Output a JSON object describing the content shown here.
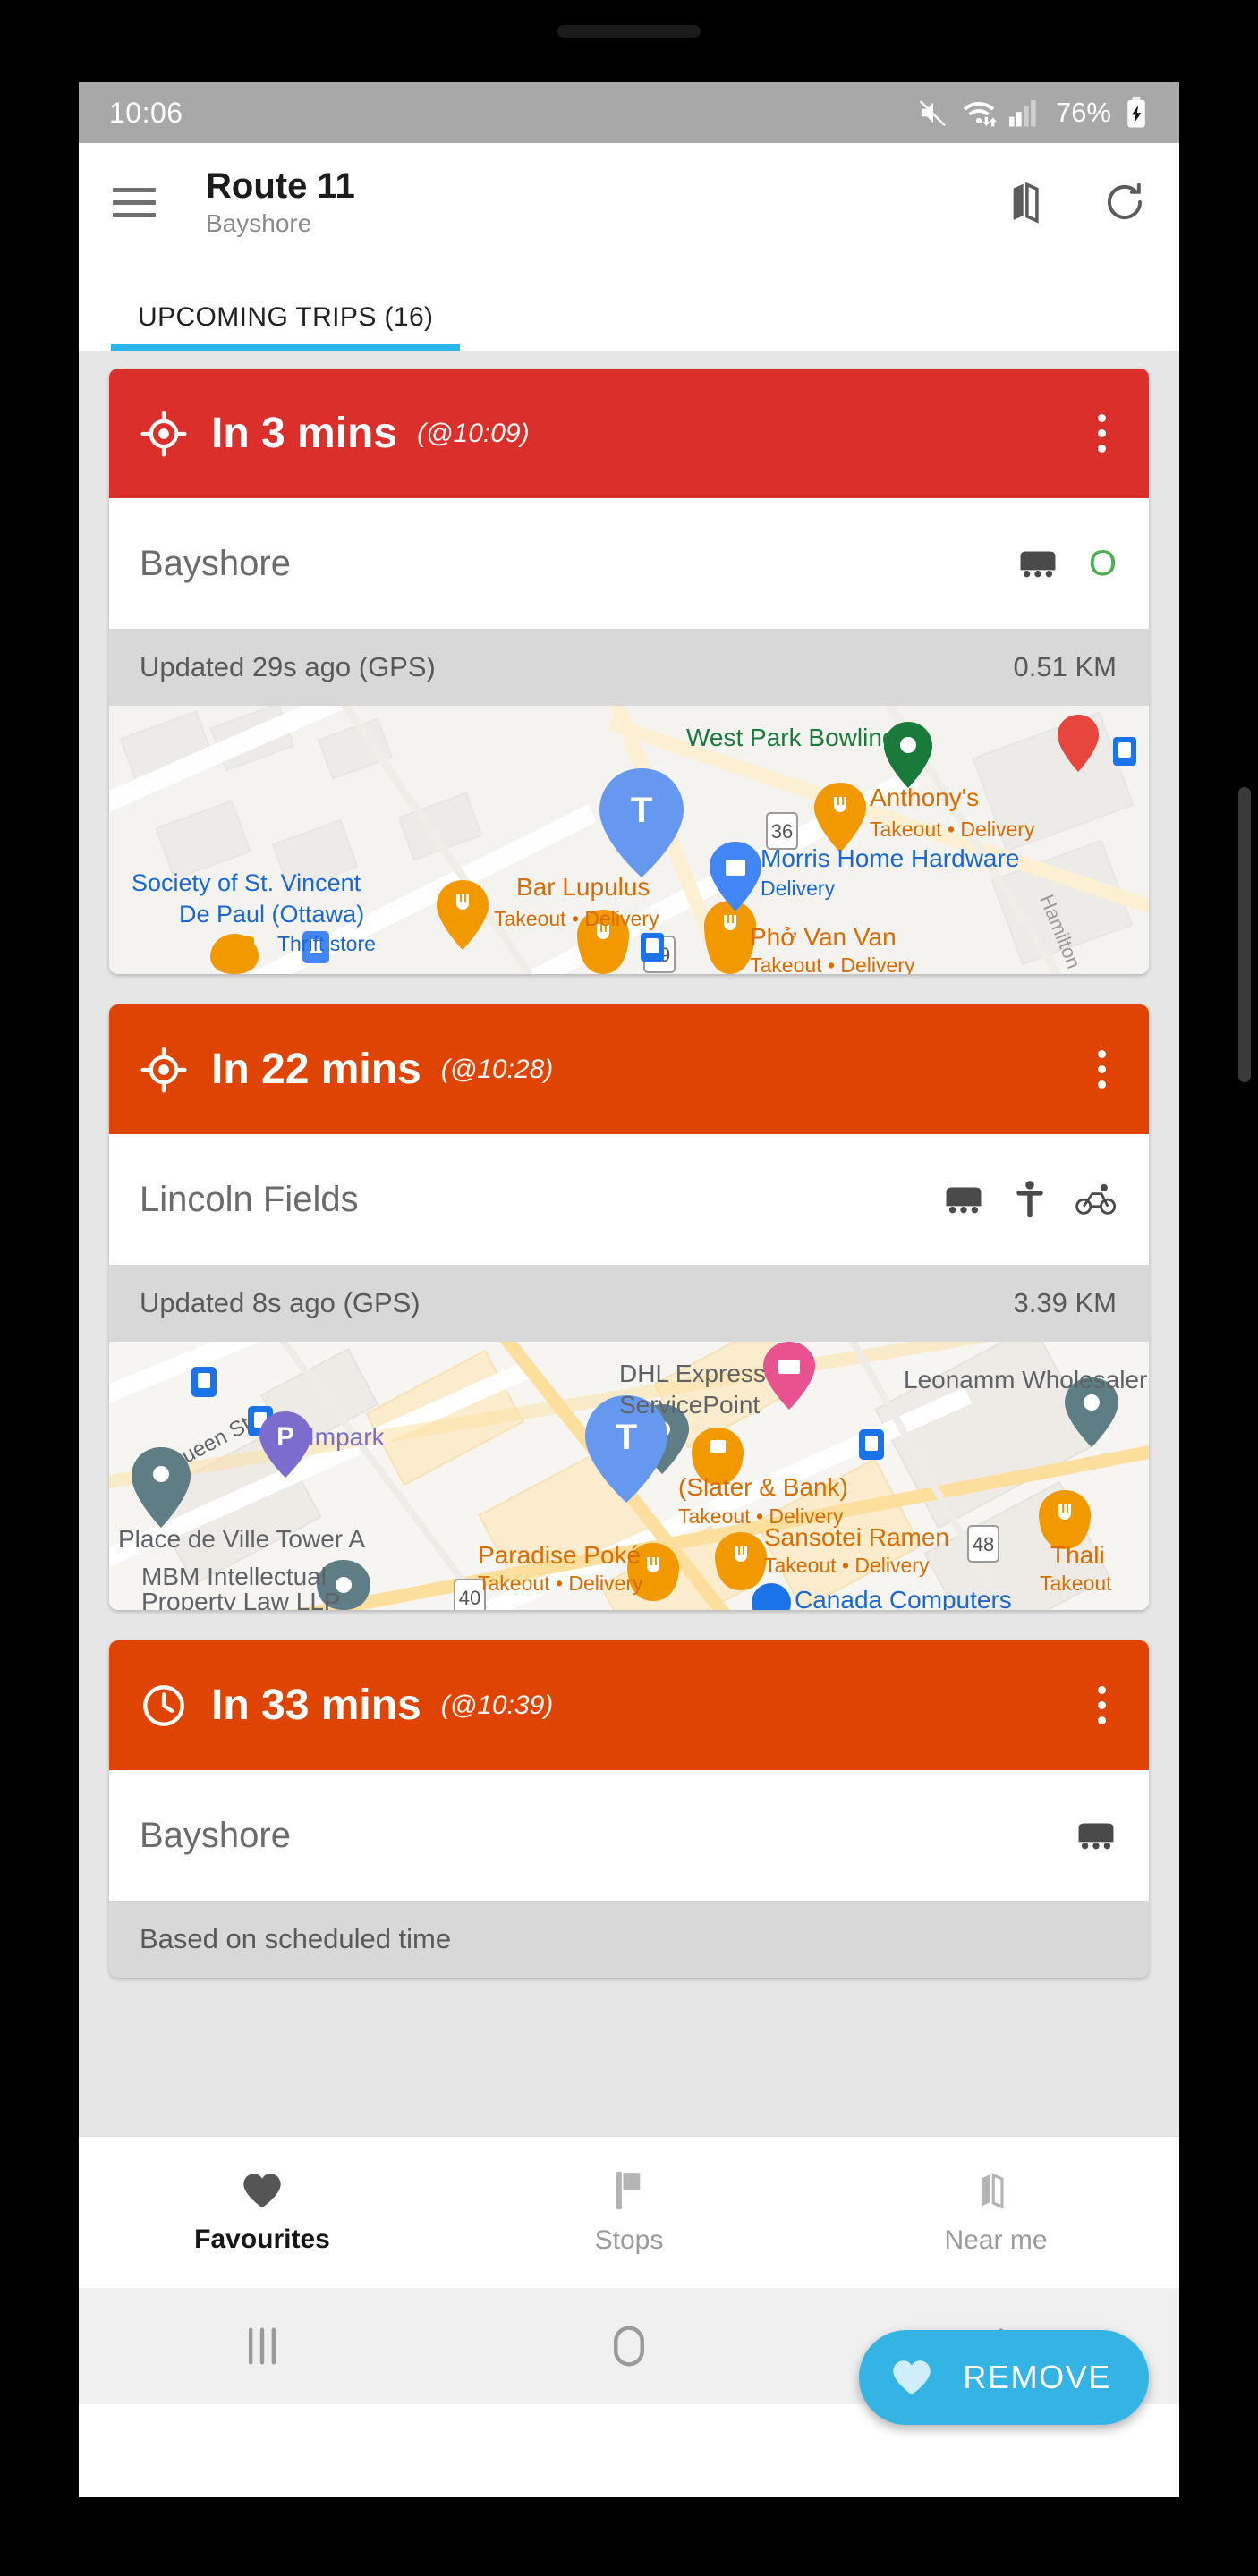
{
  "status_bar": {
    "clock": "10:06",
    "battery_percent": "76%",
    "icons": [
      "mute-icon",
      "wifi-icon",
      "signal-icon",
      "battery-charging-icon"
    ]
  },
  "app_bar": {
    "menu_icon": "hamburger-menu-icon",
    "title": "Route 11",
    "subtitle": "Bayshore",
    "map_icon": "map-icon",
    "refresh_icon": "refresh-icon"
  },
  "tabs": [
    {
      "label": "UPCOMING TRIPS (16)",
      "active": true
    }
  ],
  "trips": [
    {
      "eta": "In 3 mins",
      "time": "(@10:09)",
      "header_color": "#da2f2b",
      "header_icon": "gps-crosshair-icon",
      "destination": "Bayshore",
      "badges": [
        "bus-icon"
      ],
      "occupancy": "O",
      "occupancy_color": "#4caf50",
      "status": "Updated 29s ago (GPS)",
      "distance": "0.51 KM",
      "has_map": true,
      "map": {
        "labels": [
          "West Park Bowling",
          "Anthony's",
          "Takeout • Delivery",
          "Morris Home Hardware",
          "Delivery",
          "Society of St. Vincent",
          "De Paul (Ottawa)",
          "Thrift store",
          "Bar Lupulus",
          "Takeout • Delivery",
          "Phở Van Van",
          "Takeout • Delivery",
          "Hamilton"
        ],
        "route_shields": [
          "36",
          "69"
        ],
        "transit_marker": "T"
      }
    },
    {
      "eta": "In 22 mins",
      "time": "(@10:28)",
      "header_color": "#e04403",
      "header_icon": "gps-crosshair-icon",
      "destination": "Lincoln Fields",
      "badges": [
        "bus-icon",
        "accessibility-icon",
        "bike-icon"
      ],
      "occupancy": "",
      "occupancy_color": "",
      "status": "Updated 8s ago (GPS)",
      "distance": "3.39 KM",
      "has_map": true,
      "map": {
        "labels": [
          "Queen St",
          "Impark",
          "DHL Express",
          "ServicePoint",
          "Leonamm Wholesaler",
          "Place de Ville Tower A",
          "(Slater & Bank)",
          "Takeout • Delivery",
          "Sansotei Ramen",
          "Takeout • Delivery",
          "Thali",
          "Takeout",
          "Paradise Poké",
          "Takeout • Delivery",
          "MBM Intellectual",
          "Property Law LLP",
          "Canada Computers"
        ],
        "route_shields": [
          "48",
          "40"
        ],
        "transit_marker": "T",
        "parking_marker": "P"
      }
    },
    {
      "eta": "In 33 mins",
      "time": "(@10:39)",
      "header_color": "#e04403",
      "header_icon": "clock-icon",
      "destination": "Bayshore",
      "badges": [
        "bus-icon"
      ],
      "occupancy": "",
      "occupancy_color": "",
      "status": "Based on scheduled time",
      "distance": "",
      "has_map": false,
      "map": null
    }
  ],
  "fab": {
    "icon": "heart-icon",
    "label": "REMOVE",
    "color": "#34b4e4"
  },
  "bottom_nav": [
    {
      "label": "Favourites",
      "icon": "heart-icon",
      "active": true
    },
    {
      "label": "Stops",
      "icon": "flag-icon",
      "active": false
    },
    {
      "label": "Near me",
      "icon": "map-icon",
      "active": false
    }
  ],
  "system_nav": [
    {
      "name": "recents-button",
      "icon": "recents-icon"
    },
    {
      "name": "home-button",
      "icon": "home-icon"
    },
    {
      "name": "back-button",
      "icon": "back-icon"
    }
  ]
}
